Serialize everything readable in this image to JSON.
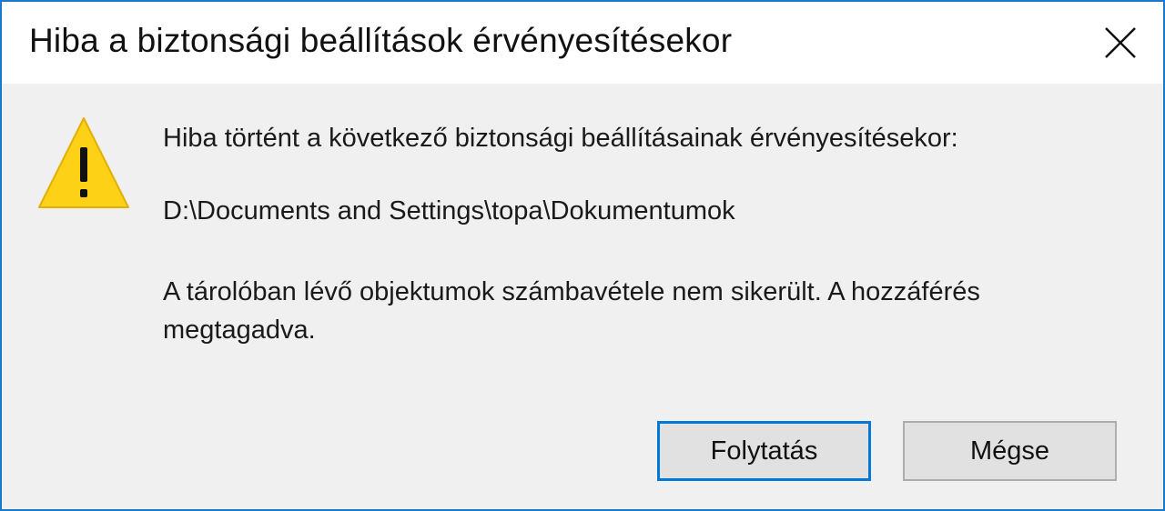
{
  "dialog": {
    "title": "Hiba a biztonsági beállítások érvényesítésekor",
    "close_icon": "close-icon",
    "warning_icon": "warning-icon",
    "messages": {
      "line1": "Hiba történt a következő biztonsági beállításainak érvényesítésekor:",
      "path": "D:\\Documents and Settings\\topa\\Dokumentumok",
      "detail": "A tárolóban lévő objektumok számbavétele nem sikerült. A hozzáférés megtagadva."
    },
    "buttons": {
      "continue_label": "Folytatás",
      "cancel_label": "Mégse"
    },
    "colors": {
      "accent": "#0078d7",
      "frame_border": "#1979ca",
      "warning_yellow": "#fcd116"
    }
  }
}
